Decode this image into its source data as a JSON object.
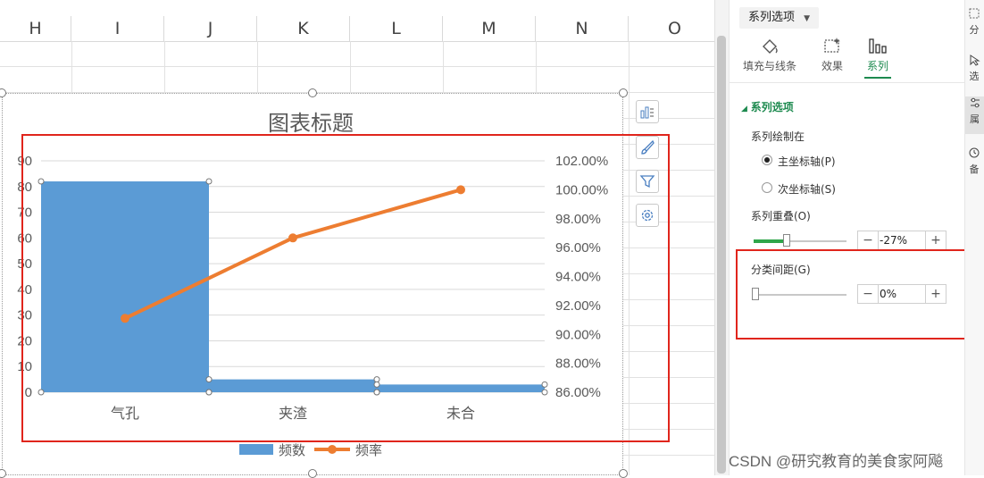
{
  "spreadsheet": {
    "columns": [
      "H",
      "I",
      "J",
      "K",
      "L",
      "M",
      "N",
      "O"
    ]
  },
  "chart": {
    "title": "图表标题",
    "legend": [
      "频数",
      "频率"
    ],
    "colors": {
      "bar": "#5b9bd5",
      "line": "#ed7d31",
      "highlight": "#e0251c"
    }
  },
  "chart_data": {
    "type": "bar",
    "categories": [
      "气孔",
      "夹渣",
      "未合"
    ],
    "series": [
      {
        "name": "频数",
        "type": "bar",
        "axis": "left",
        "values": [
          82,
          5,
          3
        ]
      },
      {
        "name": "频率",
        "type": "line",
        "axis": "right",
        "values": [
          0.9111,
          0.9667,
          1.0
        ]
      }
    ],
    "y_left": {
      "min": 0,
      "max": 90,
      "ticks": [
        "0",
        "10",
        "20",
        "30",
        "40",
        "50",
        "60",
        "70",
        "80",
        "90"
      ]
    },
    "y_right": {
      "min": 0.86,
      "max": 1.02,
      "ticks": [
        "86.00%",
        "88.00%",
        "90.00%",
        "92.00%",
        "94.00%",
        "96.00%",
        "98.00%",
        "100.00%",
        "102.00%"
      ]
    },
    "gap_width": "0%",
    "grid": true,
    "legend_position": "bottom"
  },
  "panel": {
    "dropdown_label": "系列选项",
    "tabs": [
      {
        "label": "填充与线条",
        "icon": "fill-icon"
      },
      {
        "label": "效果",
        "icon": "effects-icon"
      },
      {
        "label": "系列",
        "icon": "series-icon"
      }
    ],
    "section_title": "系列选项",
    "plot_on_label": "系列绘制在",
    "primary_axis": "主坐标轴(P)",
    "secondary_axis": "次坐标轴(S)",
    "overlap_label": "系列重叠(O)",
    "overlap_value": "-27%",
    "gap_label": "分类间距(G)",
    "gap_value": "0%",
    "minus": "−",
    "plus": "+"
  },
  "right_strip": [
    "分",
    "选",
    "属",
    "备"
  ],
  "watermark": "CSDN @研究教育的美食家阿飚"
}
